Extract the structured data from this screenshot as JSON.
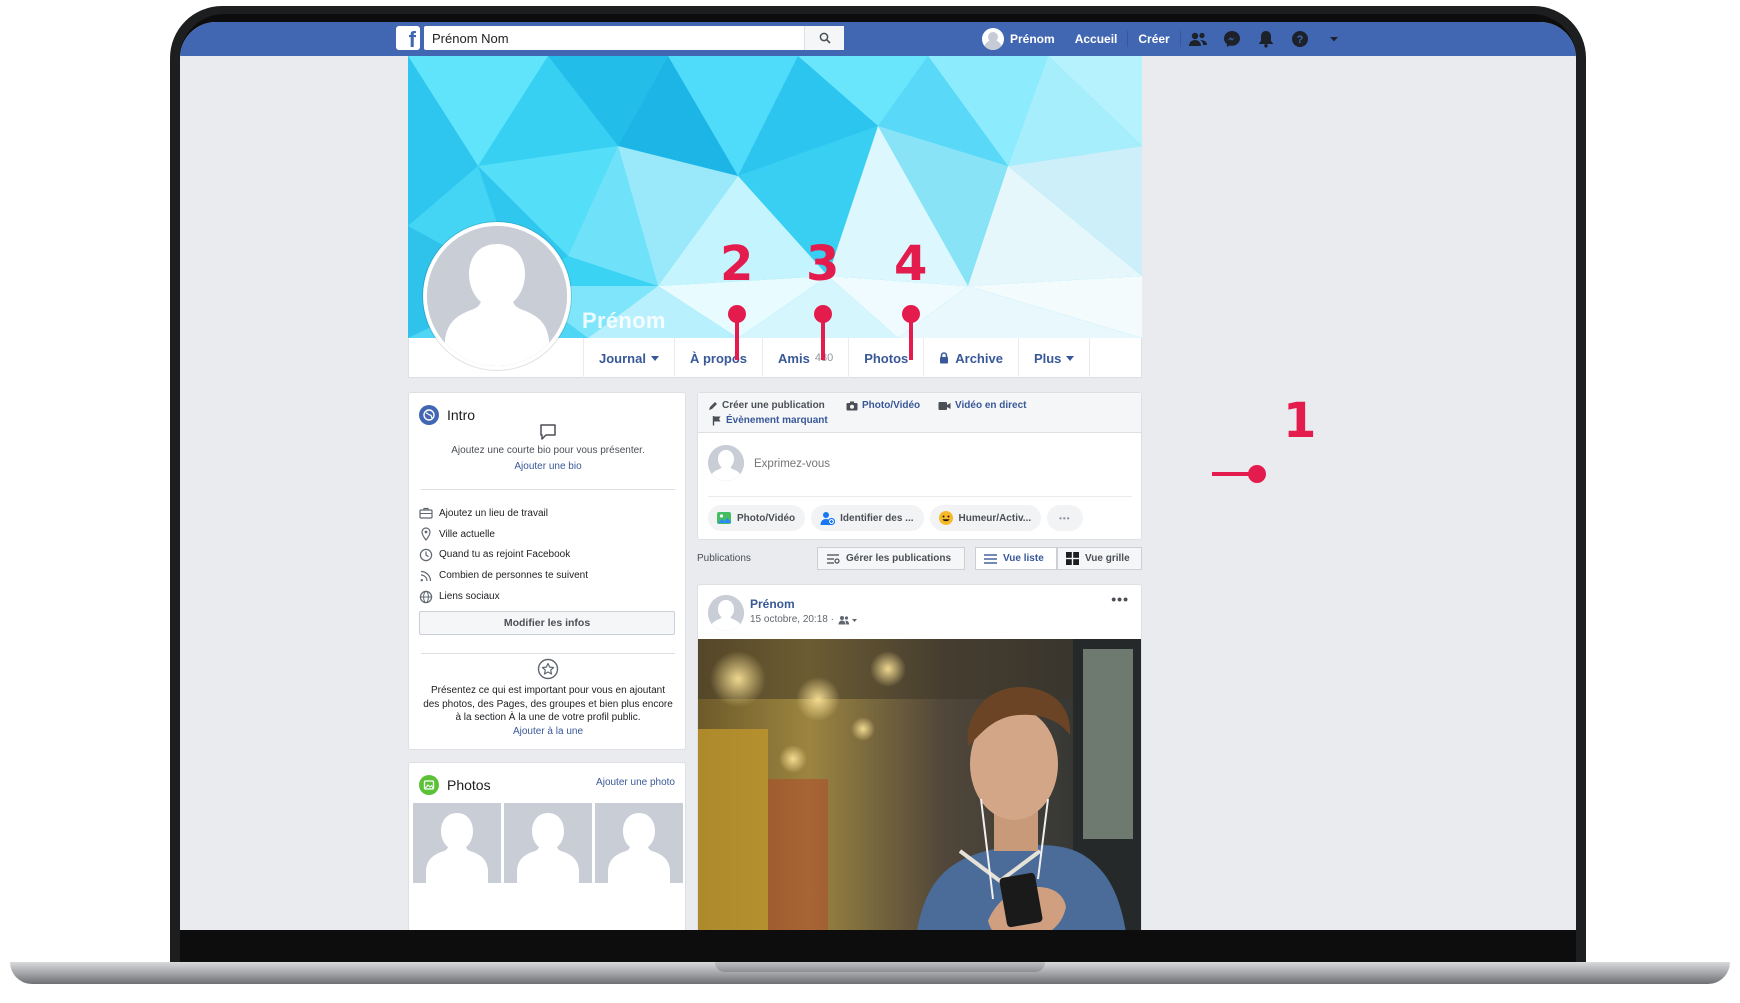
{
  "topbar": {
    "logo": "f",
    "search_value": "Prénom Nom",
    "user_name": "Prénom",
    "home_label": "Accueil",
    "create_label": "Créer"
  },
  "cover": {
    "name": "Prénom"
  },
  "profile_tabs": {
    "journal": "Journal",
    "about": "À propos",
    "friends": "Amis",
    "friends_count": "480",
    "photos": "Photos",
    "archive": "Archive",
    "more": "Plus"
  },
  "intro": {
    "title": "Intro",
    "bio_prompt": "Ajoutez une courte bio pour vous présenter.",
    "add_bio": "Ajouter une bio",
    "items": [
      "Ajoutez un lieu de travail",
      "Ville actuelle",
      "Quand tu as rejoint Facebook",
      "Combien de personnes te suivent",
      "Liens sociaux"
    ],
    "edit_button": "Modifier les infos",
    "featured_text": "Présentez ce qui est important pour vous en ajoutant des photos, des Pages, des groupes et bien plus encore à la section À la une de votre profil public.",
    "featured_link": "Ajouter à la une"
  },
  "photos_card": {
    "title": "Photos",
    "add_link": "Ajouter une photo"
  },
  "composer": {
    "create_post": "Créer une publication",
    "photo_video": "Photo/Vidéo",
    "live_video": "Vidéo en direct",
    "life_event": "Évènement marquant",
    "placeholder": "Exprimez-vous",
    "pill_photo": "Photo/Vidéo",
    "pill_tag": "Identifier des ...",
    "pill_mood": "Humeur/Activ...",
    "pill_more": "•••"
  },
  "publications": {
    "label": "Publications",
    "manage": "Gérer les publications",
    "list_view": "Vue liste",
    "grid_view": "Vue grille"
  },
  "post": {
    "author": "Prénom",
    "date": "15 octobre, 20:18 ·",
    "more": "•••"
  },
  "annotations": [
    "1",
    "2",
    "3",
    "4"
  ],
  "colors": {
    "brand_blue": "#4267b2",
    "link_blue": "#385898",
    "annotation_red": "#e31c4d",
    "page_bg": "#e9ebee"
  }
}
